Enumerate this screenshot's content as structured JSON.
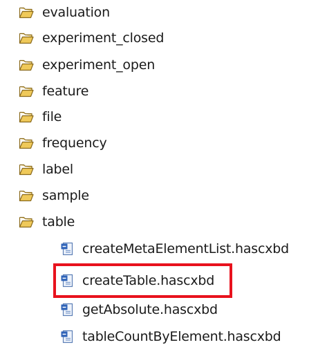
{
  "tree": {
    "folders": [
      {
        "label": "evaluation",
        "icon": "folder-open-icon"
      },
      {
        "label": "experiment_closed",
        "icon": "folder-open-icon"
      },
      {
        "label": "experiment_open",
        "icon": "folder-open-icon"
      },
      {
        "label": "feature",
        "icon": "folder-open-icon"
      },
      {
        "label": "file",
        "icon": "folder-open-icon"
      },
      {
        "label": "frequency",
        "icon": "folder-open-icon"
      },
      {
        "label": "label",
        "icon": "folder-open-icon"
      },
      {
        "label": "sample",
        "icon": "folder-open-icon"
      },
      {
        "label": "table",
        "icon": "folder-open-icon"
      }
    ],
    "files": [
      {
        "label": "createMetaElementList.hascxbd",
        "icon": "xml-file-icon"
      },
      {
        "label": "createTable.hascxbd",
        "icon": "xml-file-icon"
      },
      {
        "label": "getAbsolute.hascxbd",
        "icon": "xml-file-icon"
      },
      {
        "label": "tableCountByElement.hascxbd",
        "icon": "xml-file-icon"
      }
    ],
    "highlighted_file": "createTable.hascxbd",
    "highlight_color": "#e8121d",
    "folder_color": "#e0b74f"
  }
}
